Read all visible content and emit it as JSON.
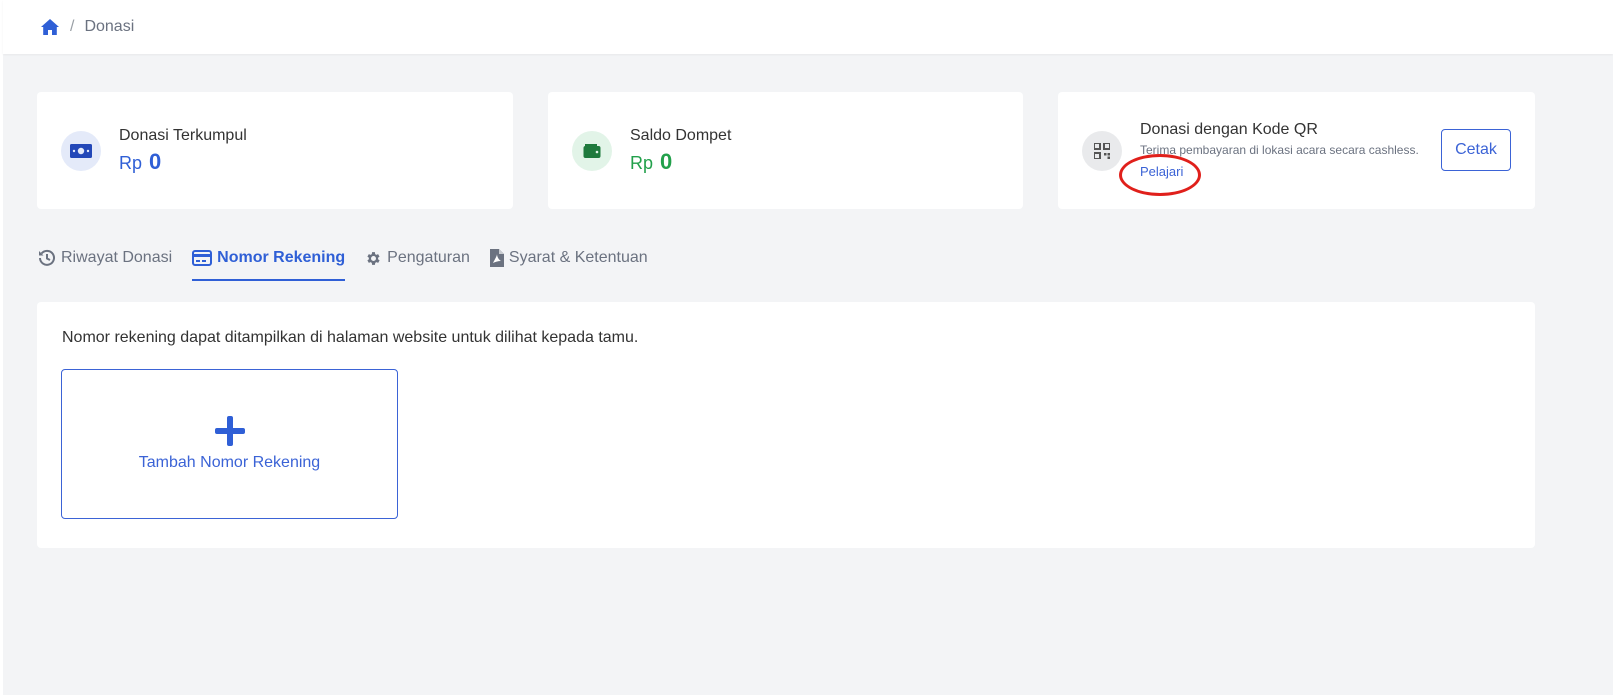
{
  "breadcrumb": {
    "home_icon": "home-icon",
    "separator": "/",
    "current": "Donasi"
  },
  "stats": [
    {
      "icon": "money-bill-icon",
      "title": "Donasi Terkumpul",
      "currency": "Rp",
      "value": "0",
      "color": "#2f5fd6"
    },
    {
      "icon": "wallet-icon",
      "title": "Saldo Dompet",
      "currency": "Rp",
      "value": "0",
      "color": "#22a04b"
    }
  ],
  "qr_card": {
    "icon": "qrcode-icon",
    "title": "Donasi dengan Kode QR",
    "description": "Terima pembayaran di lokasi acara secara cashless.",
    "link": "Pelajari",
    "button": "Cetak"
  },
  "tabs": [
    {
      "icon": "history-icon",
      "label": "Riwayat Donasi",
      "active": false
    },
    {
      "icon": "credit-card-icon",
      "label": "Nomor Rekening",
      "active": true
    },
    {
      "icon": "gear-icon",
      "label": "Pengaturan",
      "active": false
    },
    {
      "icon": "file-pdf-icon",
      "label": "Syarat & Ketentuan",
      "active": false
    }
  ],
  "panel": {
    "description": "Nomor rekening dapat ditampilkan di halaman website untuk dilihat kepada tamu.",
    "add_label": "Tambah Nomor Rekening"
  },
  "colors": {
    "accent": "#2f5fd6",
    "success": "#22a04b",
    "annotation": "#e0201b",
    "background": "#f3f4f6"
  }
}
